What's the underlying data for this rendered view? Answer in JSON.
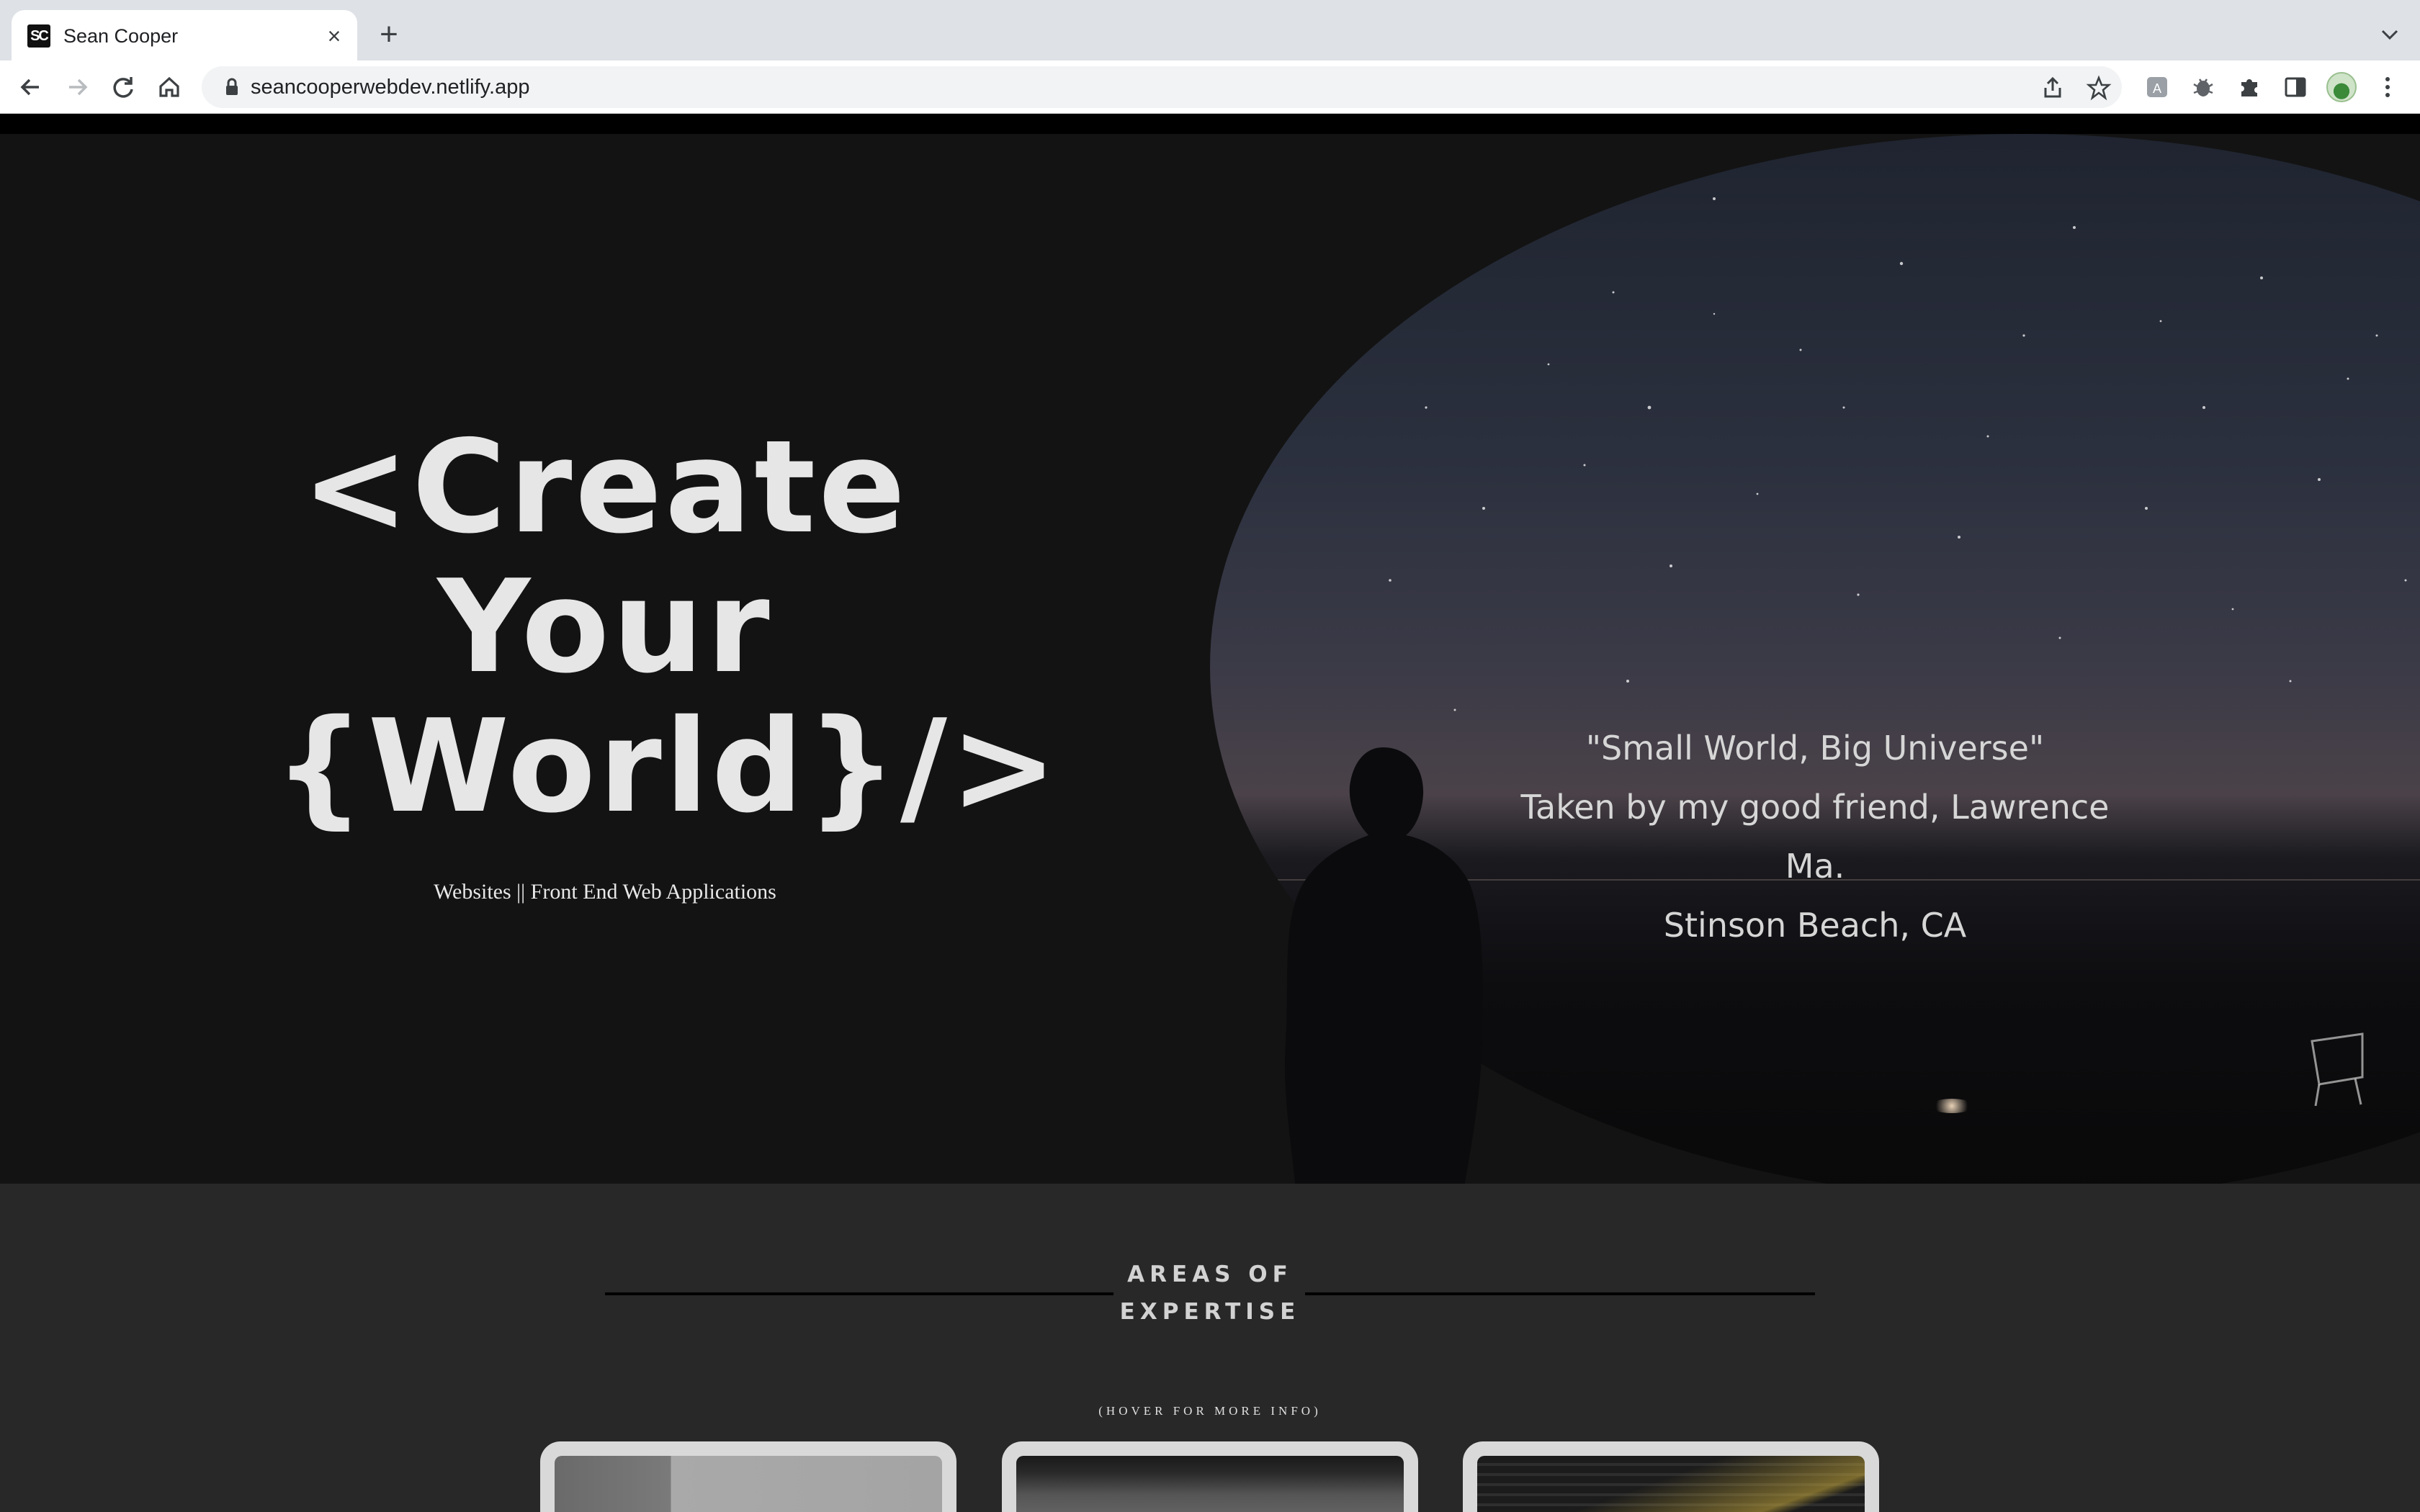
{
  "browser": {
    "tab_title": "Sean Cooper",
    "favicon_text": "SC",
    "url": "seancooperwebdev.netlify.app"
  },
  "hero": {
    "title_lines": [
      "<Create",
      "Your",
      "{World}/>"
    ],
    "subtitle": "Websites || Front End Web Applications",
    "photo_caption": [
      "\"Small World, Big Universe\"",
      "Taken by my good friend, Lawrence",
      "Ma.",
      "Stinson Beach, CA"
    ]
  },
  "expertise": {
    "heading_lines": [
      "AREAS OF",
      "EXPERTISE"
    ],
    "hover_hint": "(HOVER FOR MORE INFO)",
    "cards": [
      {
        "image": "laptop-photo"
      },
      {
        "image": "keyboard-photo"
      },
      {
        "image": "code-photo"
      }
    ]
  },
  "colors": {
    "hero_bg": "#131313",
    "section_bg": "#282828",
    "hero_text": "#e6e6e6",
    "card_frame": "#d9d9d9"
  }
}
